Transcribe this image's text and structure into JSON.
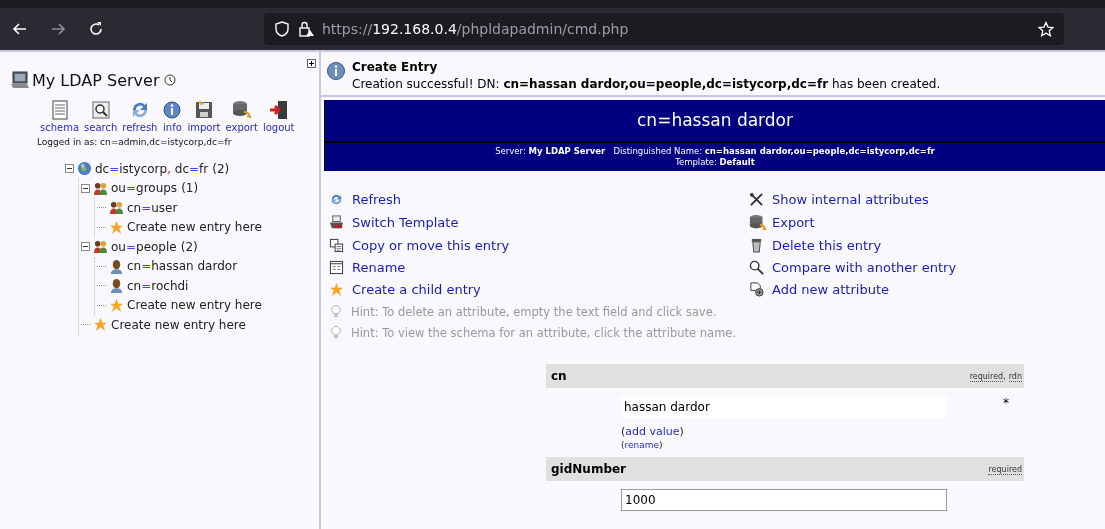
{
  "browser": {
    "url_scheme": "https://",
    "url_host": "192.168.0.4",
    "url_path": "/phpldapadmin/cmd.php",
    "forward_disabled": true
  },
  "sidebar": {
    "server_name": "My LDAP Server",
    "tools": [
      {
        "kind": "schema",
        "label": "schema"
      },
      {
        "kind": "search",
        "label": "search"
      },
      {
        "kind": "refresh",
        "label": "refresh"
      },
      {
        "kind": "info",
        "label": "info"
      },
      {
        "kind": "import",
        "label": "import"
      },
      {
        "kind": "export",
        "label": "export"
      },
      {
        "kind": "logout",
        "label": "logout"
      }
    ],
    "logged_in": "Logged in as: cn=admin,dc=istycorp,dc=fr",
    "tree": [
      {
        "kind": "domain",
        "label": "dc=istycorp, dc=fr",
        "count": "(2)",
        "expanded": true,
        "children": [
          {
            "kind": "group",
            "label": "ou=groups",
            "count": "(1)",
            "expanded": true,
            "children": [
              {
                "kind": "group",
                "label": "cn=user"
              },
              {
                "kind": "create",
                "label": "Create new entry here"
              }
            ]
          },
          {
            "kind": "group",
            "label": "ou=people",
            "count": "(2)",
            "expanded": true,
            "children": [
              {
                "kind": "person",
                "label": "cn=hassan dardor"
              },
              {
                "kind": "person",
                "label": "cn=rochdi"
              },
              {
                "kind": "create",
                "label": "Create new entry here"
              }
            ]
          },
          {
            "kind": "create",
            "label": "Create new entry here"
          }
        ]
      }
    ]
  },
  "message": {
    "title": "Create Entry",
    "text": "Creation successful! DN: **cn=hassan dardor,ou=people,dc=istycorp,dc=fr** has been created."
  },
  "entry_header": {
    "title": "cn=hassan dardor",
    "server_label": "Server:",
    "server": "My LDAP Server",
    "dn_label": "Distinguished Name:",
    "dn": "cn=hassan dardor,ou=people,dc=istycorp,dc=fr",
    "template_label": "Template:",
    "template": "Default"
  },
  "actions_left": [
    {
      "kind": "refresh",
      "label": "Refresh"
    },
    {
      "kind": "template",
      "label": "Switch Template"
    },
    {
      "kind": "copy",
      "label": "Copy or move this entry"
    },
    {
      "kind": "rename",
      "label": "Rename"
    },
    {
      "kind": "star",
      "label": "Create a child entry"
    }
  ],
  "actions_right": [
    {
      "kind": "tools",
      "label": "Show internal attributes"
    },
    {
      "kind": "export",
      "label": "Export"
    },
    {
      "kind": "trash",
      "label": "Delete this entry"
    },
    {
      "kind": "compare",
      "label": "Compare with another entry"
    },
    {
      "kind": "add",
      "label": "Add new attribute"
    }
  ],
  "hints": [
    "Hint: To delete an attribute, empty the text field and click save.",
    "Hint: To view the schema for an attribute, click the attribute name."
  ],
  "attributes": [
    {
      "name": "cn",
      "flags": [
        "required",
        "rdn"
      ],
      "flag_separator": ",",
      "value": "hassan dardor",
      "readonly": true,
      "marker": "*",
      "links": [
        {
          "open": "(",
          "text": "add value",
          "close": ")"
        },
        {
          "open": "(",
          "text": "rename",
          "close": ")"
        }
      ]
    },
    {
      "name": "gidNumber",
      "flags": [
        "required"
      ],
      "value": "1000",
      "readonly": false
    }
  ]
}
